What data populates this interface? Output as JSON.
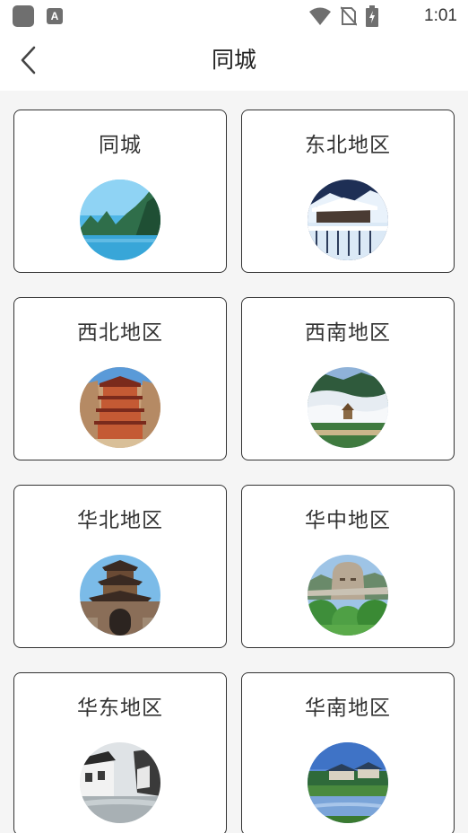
{
  "status_bar": {
    "time": "1:01"
  },
  "header": {
    "title": "同城"
  },
  "regions": [
    {
      "label": "同城",
      "image": "lake-mountains"
    },
    {
      "label": "东北地区",
      "image": "snow-village"
    },
    {
      "label": "西北地区",
      "image": "pagoda-grottoes"
    },
    {
      "label": "西南地区",
      "image": "misty-mountains"
    },
    {
      "label": "华北地区",
      "image": "gate-tower"
    },
    {
      "label": "华中地区",
      "image": "stone-head-statue"
    },
    {
      "label": "华东地区",
      "image": "water-town"
    },
    {
      "label": "华南地区",
      "image": "garden-pond"
    }
  ]
}
